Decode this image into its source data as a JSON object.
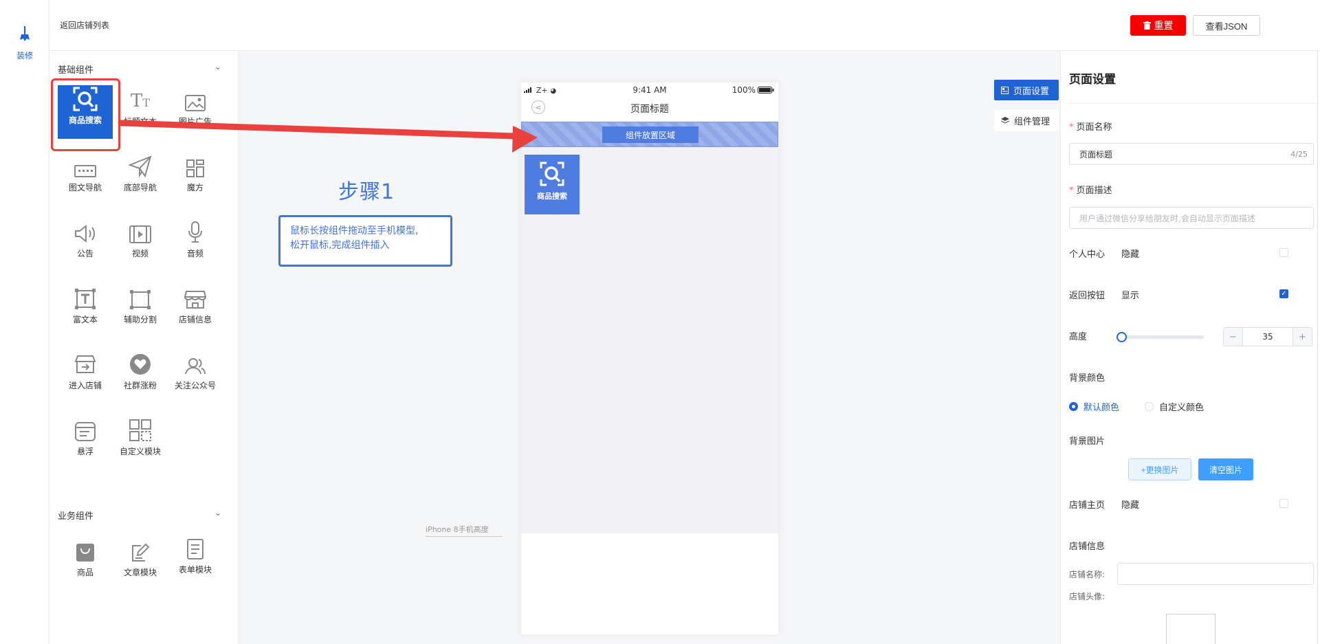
{
  "rail": {
    "label": "装修"
  },
  "topbar": {
    "back_link": "返回店铺列表",
    "reset_label": "重置",
    "json_label": "查看JSON"
  },
  "components": {
    "basic_title": "基础组件",
    "basic": [
      {
        "label": "商品搜索",
        "icon": "search-scan-icon"
      },
      {
        "label": "标题文本",
        "icon": "title-text-icon"
      },
      {
        "label": "图片广告",
        "icon": "image-icon"
      },
      {
        "label": "图文导航",
        "icon": "image-nav-icon"
      },
      {
        "label": "底部导航",
        "icon": "paper-plane-icon"
      },
      {
        "label": "魔方",
        "icon": "cube-grid-icon"
      },
      {
        "label": "公告",
        "icon": "speaker-icon"
      },
      {
        "label": "视频",
        "icon": "video-icon"
      },
      {
        "label": "音频",
        "icon": "microphone-icon"
      },
      {
        "label": "富文本",
        "icon": "rich-text-icon"
      },
      {
        "label": "辅助分割",
        "icon": "divider-icon"
      },
      {
        "label": "店铺信息",
        "icon": "store-icon"
      },
      {
        "label": "进入店铺",
        "icon": "store-enter-icon"
      },
      {
        "label": "社群涨粉",
        "icon": "heart-group-icon"
      },
      {
        "label": "关注公众号",
        "icon": "follow-icon"
      },
      {
        "label": "悬浮",
        "icon": "float-icon"
      },
      {
        "label": "自定义模块",
        "icon": "custom-module-icon"
      }
    ],
    "business_title": "业务组件",
    "business": [
      {
        "label": "商品",
        "icon": "bag-icon"
      },
      {
        "label": "文章模块",
        "icon": "edit-doc-icon"
      },
      {
        "label": "表单模块",
        "icon": "form-doc-icon"
      }
    ]
  },
  "canvas": {
    "step_title": "步骤1",
    "step_line1": "鼠标长按组件拖动至手机模型,",
    "step_line2": "松开鼠标,完成组件插入",
    "iphone_label": "iPhone 8手机高度",
    "phone": {
      "carrier": "Z+",
      "time": "9:41 AM",
      "battery": "100%",
      "page_title": "页面标题",
      "drop_zone": "组件放置区域",
      "placed_component": "商品搜索"
    }
  },
  "right_tabs": {
    "page_settings": "页面设置",
    "component_manage": "组件管理"
  },
  "settings": {
    "heading": "页面设置",
    "page_name_label": "页面名称",
    "page_name_value": "页面标题",
    "page_name_count": "4/25",
    "page_desc_label": "页面描述",
    "page_desc_placeholder": "用户通过微信分享给朋友时,会自动显示页面描述",
    "personal_center_label": "个人中心",
    "personal_center_value": "隐藏",
    "personal_center_checked": false,
    "back_button_label": "返回按钮",
    "back_button_value": "显示",
    "back_button_checked": true,
    "height_label": "高度",
    "height_value": "35",
    "height_slider_fraction": 0,
    "bg_color_label": "背景颜色",
    "bg_color_default": "默认颜色",
    "bg_color_custom": "自定义颜色",
    "bg_image_label": "背景图片",
    "change_image": "+更换图片",
    "clear_image": "清空图片",
    "shop_home_label": "店铺主页",
    "shop_home_value": "隐藏",
    "shop_home_checked": false,
    "shop_info_label": "店铺信息",
    "shop_name_label": "店铺名称:",
    "shop_avatar_label": "店铺头像:"
  },
  "colors": {
    "accent": "#1e64d4",
    "danger": "#f80000",
    "callout": "#e8413e",
    "step": "#3f73e0"
  }
}
